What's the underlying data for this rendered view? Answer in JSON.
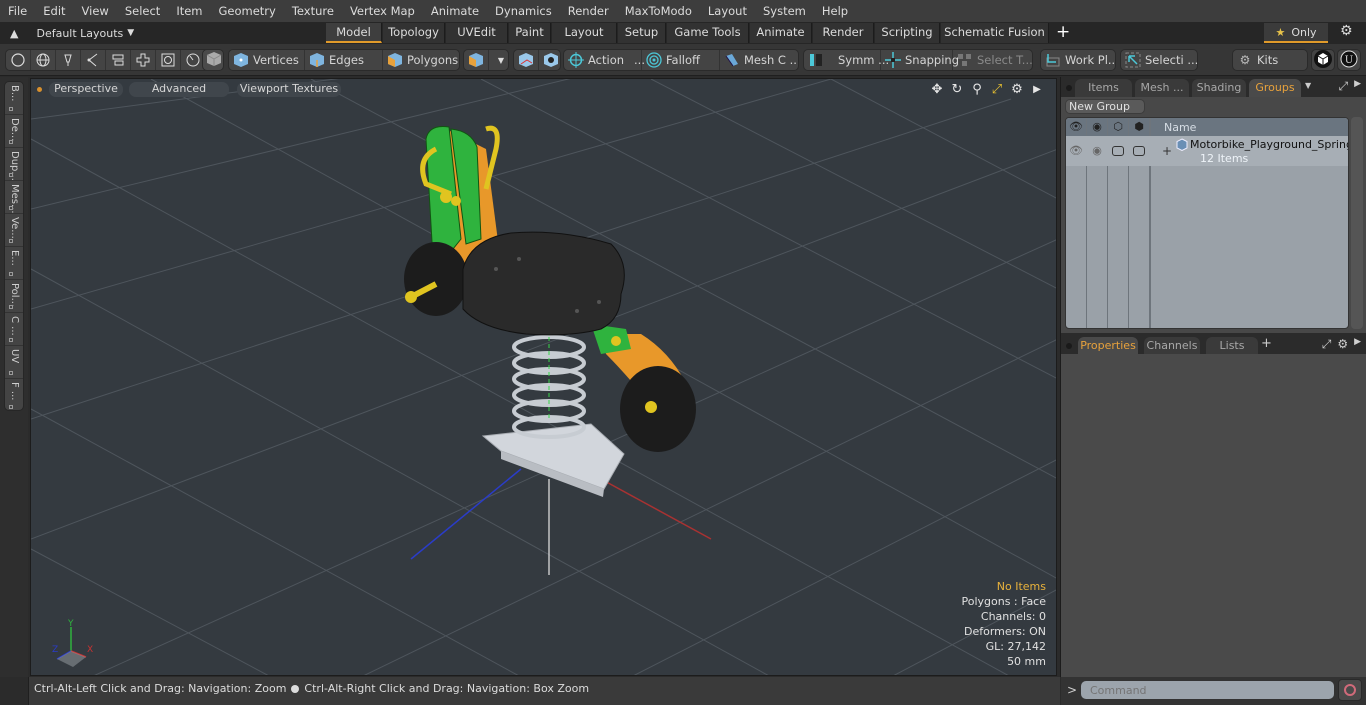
{
  "menu": [
    "File",
    "Edit",
    "View",
    "Select",
    "Item",
    "Geometry",
    "Texture",
    "Vertex Map",
    "Animate",
    "Dynamics",
    "Render",
    "MaxToModo",
    "Layout",
    "System",
    "Help"
  ],
  "layoutbar": {
    "layouts_label": "Default Layouts",
    "tabs": [
      "Model",
      "Topology",
      "UVEdit",
      "Paint",
      "Layout",
      "Setup",
      "Game Tools",
      "Animate",
      "Render",
      "Scripting",
      "Schematic Fusion"
    ],
    "active_tab": "Model",
    "add_tab": "+",
    "only_label": "Only"
  },
  "toolbar": {
    "vertices": "Vertices",
    "edges": "Edges",
    "polygons": "Polygons",
    "action": "Action",
    "action_more": "...",
    "falloff": "Falloff",
    "mesh_c": "Mesh C ...",
    "symm": "Symm ...",
    "snapping": "Snapping",
    "select_t": "Select T...",
    "work_pl": "Work Pl...",
    "selecti": "Selecti ...",
    "kits": "Kits"
  },
  "leftstrip": [
    "B...",
    "De...",
    "Dup...",
    "Mes...",
    "Ve...",
    "E...",
    "Pol...",
    "C ...",
    "UV",
    "F ..."
  ],
  "viewport": {
    "view_mode": "Perspective",
    "shading": "Advanced",
    "textures": "Viewport Textures",
    "info": {
      "selection": "No Items",
      "polygons": "Polygons : Face",
      "channels": "Channels: 0",
      "deformers": "Deformers: ON",
      "gl": "GL: 27,142",
      "scale": "50 mm"
    },
    "axis_labels": {
      "x": "X",
      "y": "Y",
      "z": "Z"
    }
  },
  "status": {
    "hint_left": "Ctrl-Alt-Left Click and Drag: Navigation: Zoom",
    "hint_right": "Ctrl-Alt-Right Click and Drag: Navigation: Box Zoom"
  },
  "rightpanel": {
    "top_tabs": [
      "Items",
      "Mesh ...",
      "Shading",
      "Groups"
    ],
    "active_top_tab": "Groups",
    "new_group": "New Group",
    "name_header": "Name",
    "group": {
      "name": "Motorbike_Playground_Spring...",
      "count": "12 Items",
      "expand": "+"
    },
    "bottom_tabs": [
      "Properties",
      "Channels",
      "Lists"
    ],
    "active_bottom_tab": "Properties",
    "add_tab": "+",
    "command_placeholder": "Command",
    "command_prompt": ">"
  },
  "colors": {
    "accent": "#e09a2a",
    "viewport_bg": "#343a40",
    "model_green": "#2fb33e",
    "model_orange": "#e8982a",
    "model_yellow": "#e8cf1c",
    "model_black": "#222222",
    "model_grey": "#c8ccd2"
  }
}
